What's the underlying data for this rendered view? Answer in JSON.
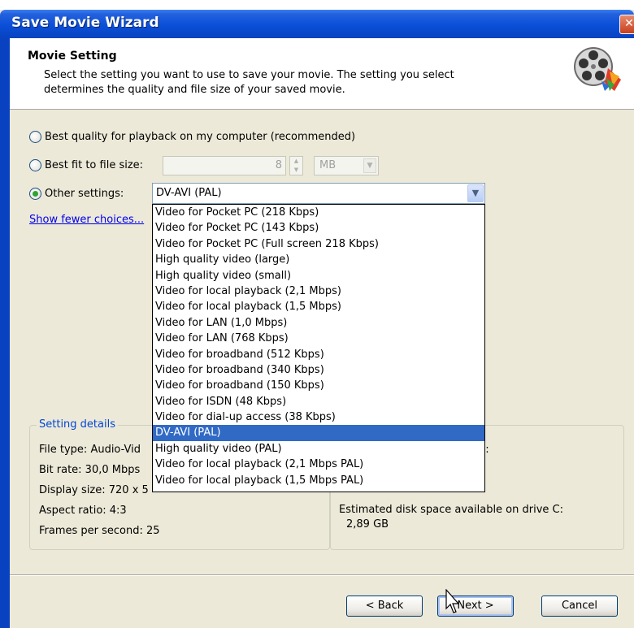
{
  "window": {
    "title": "Save Movie Wizard",
    "close_glyph": "✕"
  },
  "header": {
    "title": "Movie Setting",
    "description": "Select the setting you want to use to save your movie. The setting you select determines the quality and file size of your saved movie.",
    "icon": "film-reel-icon"
  },
  "options": {
    "best_quality_label": "Best quality for playback on my computer (recommended)",
    "best_fit_label": "Best fit to file size:",
    "file_size_value": "8",
    "file_size_unit": "MB",
    "other_label": "Other settings:",
    "other_selected": "DV-AVI (PAL)",
    "selected_option": "other"
  },
  "show_fewer_link": "Show fewer choices...",
  "dropdown_items": [
    "Video for Pocket PC (218 Kbps)",
    "Video for Pocket PC (143 Kbps)",
    "Video for Pocket PC (Full screen 218 Kbps)",
    "High quality video (large)",
    "High quality video (small)",
    "Video for local playback (2,1 Mbps)",
    "Video for local playback (1,5 Mbps)",
    "Video for LAN (1,0 Mbps)",
    "Video for LAN (768 Kbps)",
    "Video for broadband (512 Kbps)",
    "Video for broadband (340 Kbps)",
    "Video for broadband (150 Kbps)",
    "Video for ISDN (48 Kbps)",
    "Video for dial-up access (38 Kbps)",
    "DV-AVI (PAL)",
    "High quality video (PAL)",
    "Video for local playback (2,1 Mbps PAL)",
    "Video for local playback (1,5 Mbps PAL)"
  ],
  "dropdown_selected_index": 14,
  "setting_details": {
    "label": "Setting details",
    "file_type": "File type: Audio-Vid",
    "bit_rate": "Bit rate: 30,0 Mbps",
    "display_size": "Display size: 720 x 5",
    "aspect_ratio": "Aspect ratio: 4:3",
    "fps": "Frames per second: 25"
  },
  "movie_file_size": {
    "partial_text": "d:",
    "disk_space_label": "Estimated disk space available on drive C:",
    "disk_space_value": "2,89 GB"
  },
  "buttons": {
    "back": "< Back",
    "next": "Next >",
    "cancel": "Cancel"
  },
  "colors": {
    "titlebar": "#0a4fd8",
    "selection": "#316ac5",
    "group_label": "#0046d5",
    "dialog_bg": "#ece9d8"
  }
}
